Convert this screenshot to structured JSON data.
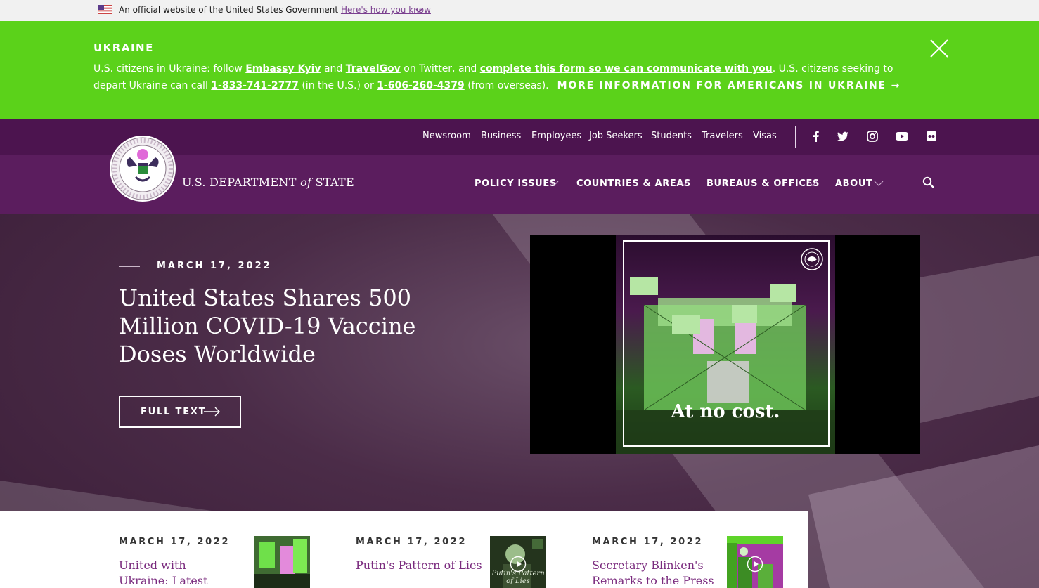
{
  "gov_banner": {
    "text": "An official website of the United States Government",
    "link": "Here's how you know"
  },
  "alert": {
    "title": "UKRAINE",
    "t1": "U.S. citizens in Ukraine: follow ",
    "l1": "Embassy Kyiv",
    "t2": " and ",
    "l2": "TravelGov",
    "t3": " on Twitter, and ",
    "l3": "complete this form so we can communicate with you",
    "t4": ". U.S. citizens seeking to depart Ukraine can call ",
    "l4": "1-833-741-2777",
    "t5": " (in the U.S.) or ",
    "l5": "1-606-260-4379",
    "t6": " (from overseas).",
    "more": "MORE INFORMATION FOR AMERICANS IN UKRAINE →"
  },
  "utility_nav": [
    "Newsroom",
    "Business",
    "Employees",
    "Job Seekers",
    "Students",
    "Travelers",
    "Visas"
  ],
  "social": [
    "facebook-icon",
    "twitter-icon",
    "instagram-icon",
    "youtube-icon",
    "flickr-icon"
  ],
  "brand": {
    "pre": "U.S. DEPARTMENT ",
    "of": "of",
    "post": " STATE"
  },
  "main_nav": [
    "POLICY ISSUES",
    "COUNTRIES & AREAS",
    "BUREAUS & OFFICES",
    "ABOUT"
  ],
  "hero": {
    "date": "MARCH 17, 2022",
    "title": "United States Shares 500 Million COVID-19 Vaccine Doses Worldwide",
    "button": "FULL TEXT",
    "video_caption": "At no cost."
  },
  "cards": [
    {
      "date": "MARCH 17, 2022",
      "title": "United with Ukraine: Latest Updates",
      "has_play": false
    },
    {
      "date": "MARCH 17, 2022",
      "title": "Putin's Pattern of Lies",
      "thumb_text": "Putin's Pattern of Lies",
      "has_play": true
    },
    {
      "date": "MARCH 17, 2022",
      "title": "Secretary Blinken's Remarks to the Press",
      "has_play": true
    }
  ],
  "colors": {
    "alert_bg": "#5bd21a",
    "header_bg": "#5b1d5e",
    "utility_bg": "#4c144f",
    "accent": "#7a2b7e"
  }
}
